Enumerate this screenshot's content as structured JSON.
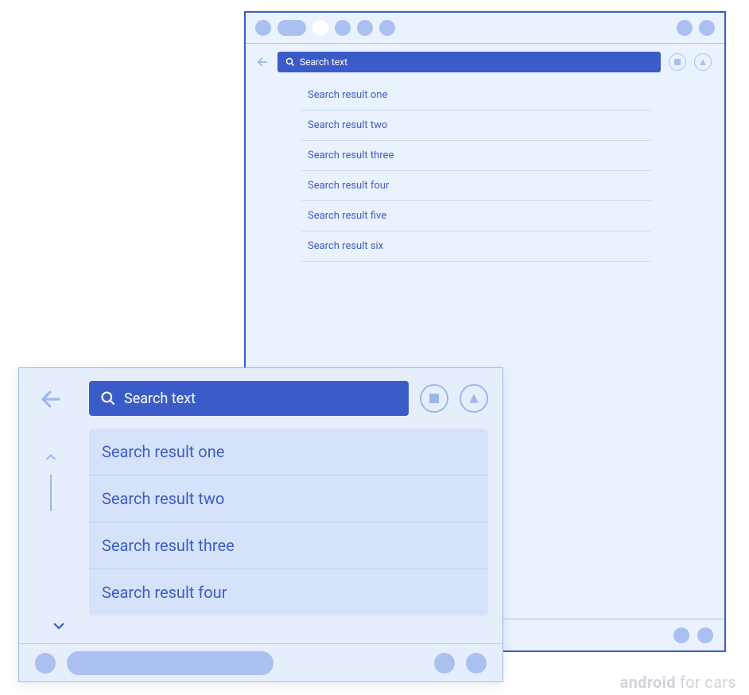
{
  "back_window": {
    "search_placeholder": "Search text",
    "results": [
      "Search result one",
      "Search result two",
      "Search result three",
      "Search result four",
      "Search result five",
      "Search result six"
    ]
  },
  "front_window": {
    "search_placeholder": "Search text",
    "results": [
      "Search result one",
      "Search result two",
      "Search result three",
      "Search result four"
    ]
  },
  "branding": {
    "bold": "android",
    "light": " for cars"
  }
}
